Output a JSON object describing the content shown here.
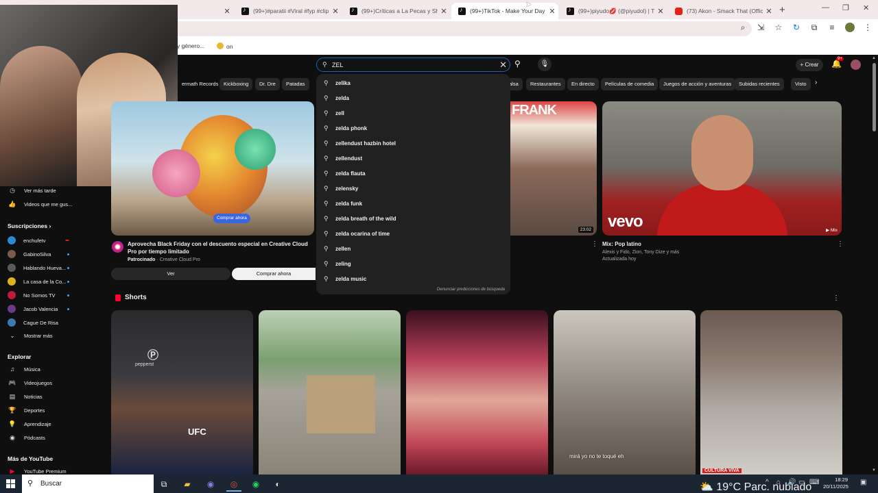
{
  "browser": {
    "tabs": [
      {
        "title": "(99+)#paratii #Viral #fyp #clip",
        "icon": "tiktok-icon"
      },
      {
        "title": "(99+)Críticas a La Pecas y Shaki",
        "icon": "tiktok-icon"
      },
      {
        "title": "(99+)TikTok - Make Your Day",
        "icon": "tiktok-icon"
      },
      {
        "title": "(99+)piyudo💋 (@piyudol) | T",
        "icon": "tiktok-icon"
      },
      {
        "title": "(73) Akon - Smack That (Officia",
        "icon": "youtube-icon"
      }
    ],
    "bookmarks": [
      "y género...",
      "on"
    ]
  },
  "header": {
    "search_query": "ZEL",
    "create_label": "Crear",
    "notification_count": "9+"
  },
  "chips": [
    "ermath Records",
    "Kickboxing",
    "Dr. Dre",
    "Patadas",
    "alsa",
    "Restaurantes",
    "En directo",
    "Películas de comedia",
    "Juegos de acción y aventuras",
    "Subidas recientes",
    "Visto"
  ],
  "suggestions": [
    "zelika",
    "zelda",
    "zell",
    "zelda phonk",
    "zellendust hazbin hotel",
    "zellendust",
    "zelda flauta",
    "zelensky",
    "zelda funk",
    "zelda breath of the wild",
    "zelda ocarina of time",
    "zellen",
    "zeling",
    "zelda music"
  ],
  "report_predictions": "Denunciar predicciones de búsqueda",
  "sidebar": {
    "top": [
      {
        "label": "Ver más tarde",
        "icon": "clock-icon"
      },
      {
        "label": "Videos que me gus...",
        "icon": "thumbs-up-icon"
      }
    ],
    "subscriptions_title": "Suscripciones",
    "subscriptions": [
      {
        "label": "enchufetv",
        "color": "#2a8ad0"
      },
      {
        "label": "GabinoSilva",
        "color": "#7a5a4a"
      },
      {
        "label": "Hablando Hueva...",
        "color": "#5a5a5a"
      },
      {
        "label": "La casa de la Co...",
        "color": "#e0b020"
      },
      {
        "label": "No Somos TV",
        "color": "#c01a3a"
      },
      {
        "label": "Jacob Valencia",
        "color": "#6a3a8a"
      },
      {
        "label": "Cague De Risa",
        "color": "#3a7ab0"
      }
    ],
    "show_more": "Mostrar más",
    "explore_title": "Explorar",
    "explore": [
      {
        "label": "Música",
        "icon": "music-icon"
      },
      {
        "label": "Videojuegos",
        "icon": "gamepad-icon"
      },
      {
        "label": "Noticias",
        "icon": "news-icon"
      },
      {
        "label": "Deportes",
        "icon": "trophy-icon"
      },
      {
        "label": "Aprendizaje",
        "icon": "bulb-icon"
      },
      {
        "label": "Pódcasts",
        "icon": "podcast-icon"
      }
    ],
    "more_title": "Más de YouTube",
    "premium": "YouTube Premium"
  },
  "ad": {
    "title": "Aprovecha Black Friday con el descuento especial en Creative Cloud Pro por tiempo limitado",
    "sponsored": "Patrocinado",
    "advertiser": "Creative Cloud Pro",
    "overlay_button": "Comprar ahora",
    "ver_label": "Ver",
    "buy_label": "Comprar ahora"
  },
  "videos": [
    {
      "thumb_text": "FRANK",
      "duration": "23:02"
    },
    {
      "title": "Mix: Pop latino",
      "line1": "Alexis y Fido, Zion, Tony Dize y más",
      "line2": "Actualizada hoy",
      "thumb_text": "vevo",
      "tag": "Mix"
    }
  ],
  "shorts": {
    "title": "Shorts",
    "items": [
      {
        "overlay": "UFC",
        "brand": "pepperst"
      },
      {
        "overlay": ""
      },
      {
        "overlay": ""
      },
      {
        "caption": "mirá yo no te toqué eh"
      },
      {
        "badge": "CULTURA VIVA"
      }
    ]
  },
  "taskbar": {
    "search_label": "Buscar",
    "weather": "19°C  Parc. nublado",
    "time": "18:29",
    "date": "20/11/2025"
  }
}
